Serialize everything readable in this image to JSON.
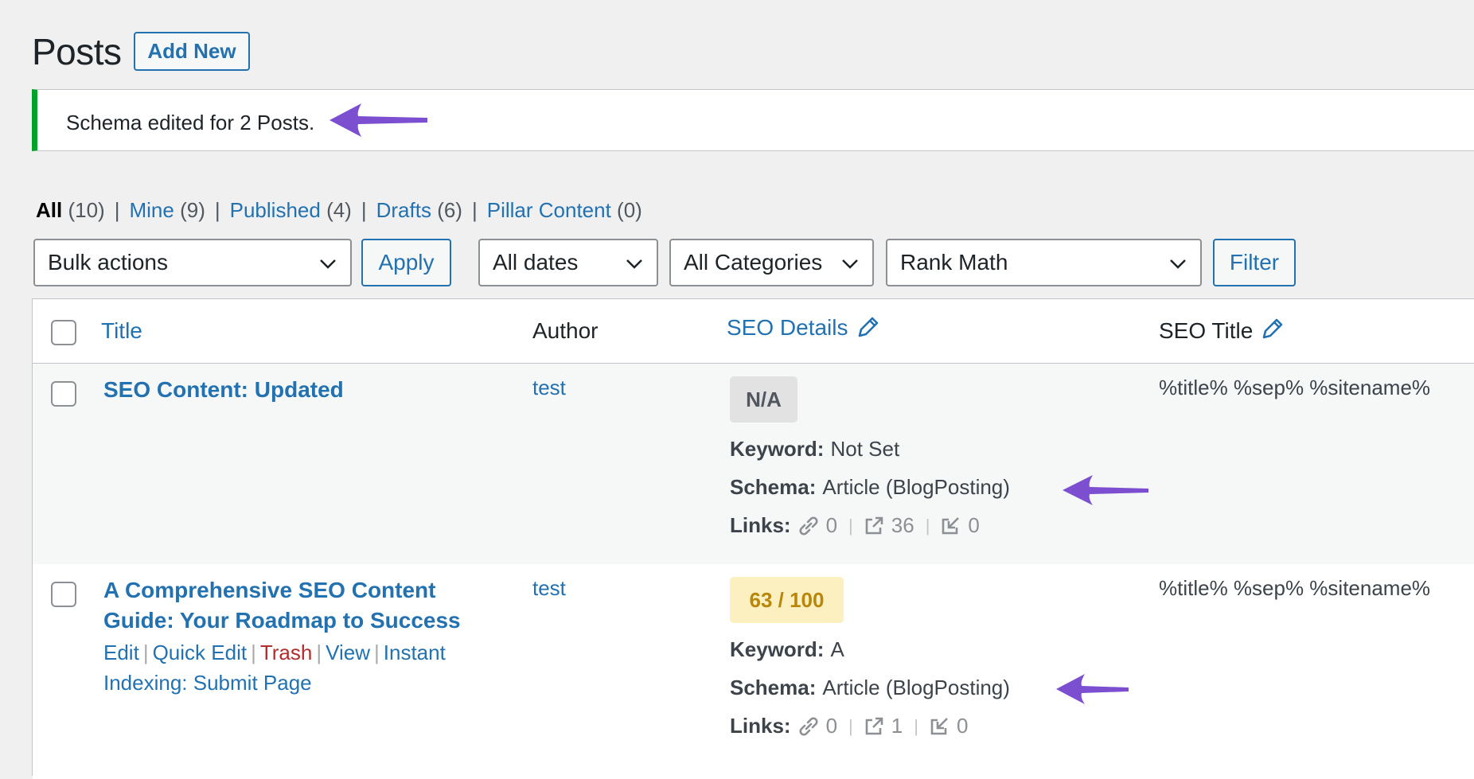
{
  "header": {
    "title": "Posts",
    "add_new_label": "Add New"
  },
  "notice": {
    "text": "Schema edited for 2 Posts."
  },
  "views": [
    {
      "label": "All",
      "count": "(10)"
    },
    {
      "label": "Mine",
      "count": "(9)"
    },
    {
      "label": "Published",
      "count": "(4)"
    },
    {
      "label": "Drafts",
      "count": "(6)"
    },
    {
      "label": "Pillar Content",
      "count": "(0)"
    }
  ],
  "separator": "|",
  "tablenav": {
    "bulk_actions": "Bulk actions",
    "apply_label": "Apply",
    "dates": "All dates",
    "categories": "All Categories",
    "seo_filter": "Rank Math",
    "filter_label": "Filter"
  },
  "columns": {
    "title": "Title",
    "author": "Author",
    "seo_details": "SEO Details",
    "seo_title": "SEO Title"
  },
  "labels": {
    "keyword": "Keyword:",
    "schema": "Schema:",
    "links": "Links:"
  },
  "posts": [
    {
      "title": "SEO Content: Updated",
      "author": "test",
      "score": "N/A",
      "keyword": "Not Set",
      "schema": "Article (BlogPosting)",
      "links": {
        "internal": "0",
        "external": "36",
        "incoming": "0"
      },
      "seo_title": "%title% %sep% %sitename%"
    },
    {
      "title_line1": "A Comprehensive SEO Content",
      "title_line2": "Guide: Your Roadmap to Success",
      "author": "test",
      "score": "63 / 100",
      "keyword": "A",
      "schema": "Article (BlogPosting)",
      "links": {
        "internal": "0",
        "external": "1",
        "incoming": "0"
      },
      "seo_title": "%title% %sep% %sitename%",
      "actions": {
        "edit": "Edit",
        "quick_edit": "Quick Edit",
        "trash": "Trash",
        "view": "View",
        "instant_1": "Instant",
        "instant_2": "Indexing: Submit Page"
      }
    }
  ],
  "colors": {
    "accent": "#2271b1",
    "notice_border": "#00a32a",
    "annotation_arrow": "#7b4fcf",
    "score_na_bg": "#e2e2e2",
    "score_ok_bg": "#fdf0c0",
    "score_ok_text": "#b8860b",
    "trash": "#b32d2e"
  }
}
